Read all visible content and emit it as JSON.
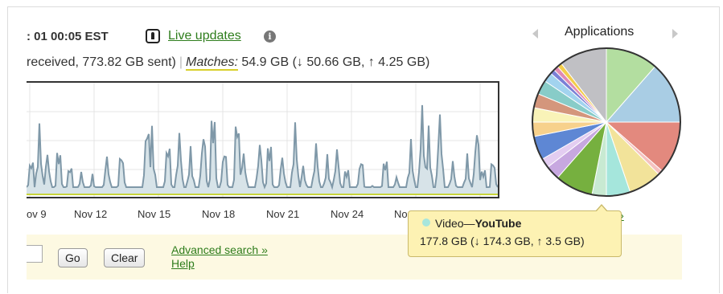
{
  "header": {
    "time_text": ": 01 00:05 EST",
    "live_updates_label": "Live updates",
    "info_icon": "i"
  },
  "stats": {
    "received_text": "received, 773.82 GB sent)",
    "matches_label": "Matches:",
    "matches_value": "54.9 GB (↓ 50.66 GB, ↑ 4.25 GB)"
  },
  "traffic_chart": {
    "x_labels": [
      "ov 9",
      "Nov 12",
      "Nov 15",
      "Nov 18",
      "Nov 21",
      "Nov 24",
      "No"
    ],
    "line_color": "#7f98a8",
    "fill_color": "#d7e3e8",
    "baseline_color": "#c8d43a"
  },
  "applications": {
    "title": "Applications",
    "more_link": "»",
    "slices": [
      {
        "color": "#b3dea0",
        "value": 11
      },
      {
        "color": "#a9cde4",
        "value": 13
      },
      {
        "color": "#e3897e",
        "value": 11
      },
      {
        "color": "#f5c2c0",
        "value": 1
      },
      {
        "color": "#f2e39a",
        "value": 7
      },
      {
        "color": "#a5e6dc",
        "value": 5
      },
      {
        "color": "#c8ead2",
        "value": 3
      },
      {
        "color": "#76b03f",
        "value": 8
      },
      {
        "color": "#c7a8e0",
        "value": 3
      },
      {
        "color": "#e3cdf1",
        "value": 2
      },
      {
        "color": "#5e87d4",
        "value": 5
      },
      {
        "color": "#f7d18c",
        "value": 3
      },
      {
        "color": "#f9f3b8",
        "value": 3
      },
      {
        "color": "#d4967c",
        "value": 3
      },
      {
        "color": "#88ccc8",
        "value": 3
      },
      {
        "color": "#a2d3ef",
        "value": 2
      },
      {
        "color": "#7b7fd6",
        "value": 1
      },
      {
        "color": "#e18ab4",
        "value": 1
      },
      {
        "color": "#f3cd4a",
        "value": 1
      },
      {
        "color": "#c0c0c4",
        "value": 10
      }
    ]
  },
  "tooltip": {
    "category": "Video—",
    "app": "YouTube",
    "detail": "177.8 GB (↓ 174.3 GB, ↑ 3.5 GB)"
  },
  "search": {
    "input_value": "",
    "go_label": "Go",
    "clear_label": "Clear",
    "advanced_label": "Advanced search »",
    "help_label": "Help"
  }
}
